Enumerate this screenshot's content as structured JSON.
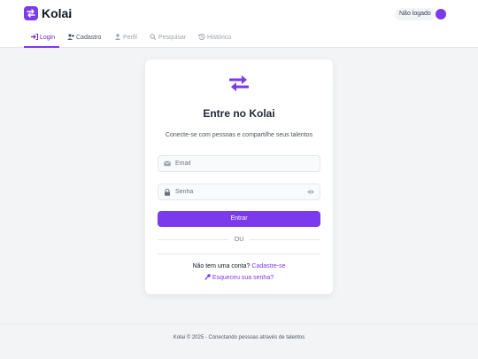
{
  "header": {
    "brand": "Kolai",
    "brand_suffix": ".",
    "status_badge": "Não logado",
    "accent_color": "#7c3aed",
    "logo_icon": "swap-arrows-icon",
    "toggle_icon": "theme-toggle-icon"
  },
  "nav": {
    "items": [
      {
        "label": "Login",
        "icon": "sign-in-icon",
        "state": "active"
      },
      {
        "label": "Cadastro",
        "icon": "user-plus-icon"
      },
      {
        "label": "Perfil",
        "icon": "user-icon"
      },
      {
        "label": "Pesquisar",
        "icon": "search-icon"
      },
      {
        "label": "Histórico",
        "icon": "history-icon"
      }
    ]
  },
  "card": {
    "icon": "swap-arrows-icon",
    "title": "Entre no Kolai",
    "subtitle": "Conecte-se com pessoas e compartilhe seus talentos",
    "email_placeholder": "Email",
    "email_icon": "envelope-icon",
    "password_placeholder": "Senha",
    "password_icon": "lock-icon",
    "password_toggle_icon": "eye-icon",
    "login_button": "Entrar",
    "divider": "OU",
    "signup_prompt": "Não tem uma conta?",
    "signup_link": "Cadastre-se",
    "forgot_icon": "key-icon",
    "forgot_link": "Esqueceu sua senha?"
  },
  "footer": {
    "text": "Kolai © 2025 - Conectando pessoas através de talentos"
  }
}
